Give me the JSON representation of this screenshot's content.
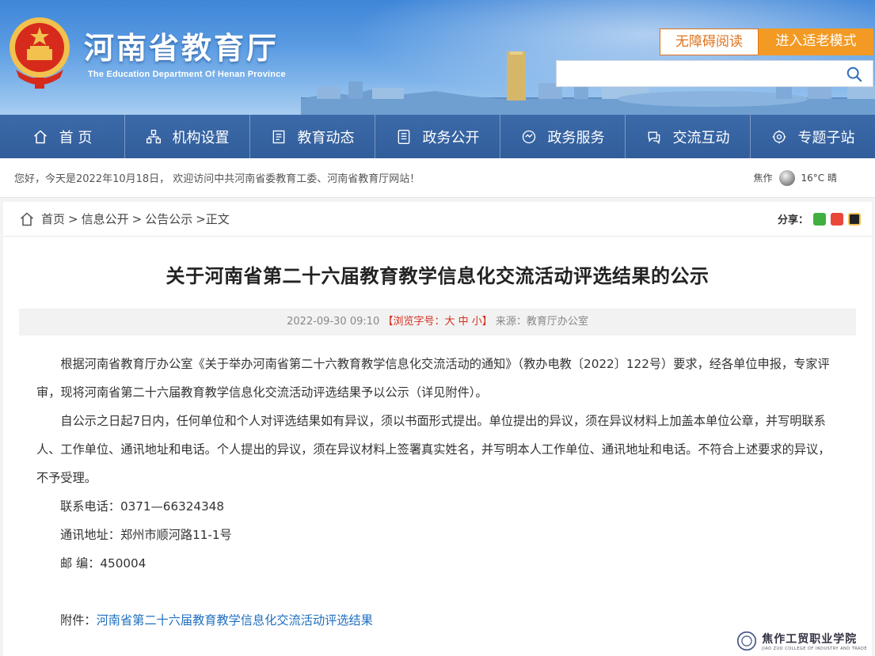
{
  "header": {
    "site_title": "河南省教育厅",
    "site_subtitle": "The Education Department Of Henan Province",
    "accessible_label": "无障碍阅读",
    "elder_mode_label": "进入适老模式",
    "search_placeholder": ""
  },
  "nav": [
    {
      "label": "首 页",
      "icon": "home-icon"
    },
    {
      "label": "机构设置",
      "icon": "org-chart-icon"
    },
    {
      "label": "教育动态",
      "icon": "news-icon"
    },
    {
      "label": "政务公开",
      "icon": "document-icon"
    },
    {
      "label": "政务服务",
      "icon": "service-icon"
    },
    {
      "label": "交流互动",
      "icon": "chat-icon"
    },
    {
      "label": "专题子站",
      "icon": "topic-icon"
    }
  ],
  "infobar": {
    "greeting": "您好，今天是2022年10月18日， 欢迎访问中共河南省委教育工委、河南省教育厅网站！",
    "city": "焦作",
    "weather": "16°C 晴"
  },
  "breadcrumb": {
    "home": "首页",
    "sep": ">",
    "level1": "信息公开",
    "level2": "公告公示",
    "current": ">正文"
  },
  "share": {
    "label": "分享："
  },
  "article": {
    "title": "关于河南省第二十六届教育教学信息化交流活动评选结果的公示",
    "date": "2022-09-30 09:10",
    "font_size_label": "【浏览字号：大 中 小】",
    "source": "来源：教育厅办公室",
    "para1": "根据河南省教育厅办公室《关于举办河南省第二十六教育教学信息化交流活动的通知》（教办电教〔2022〕122号）要求，经各单位申报，专家评审，现将河南省第二十六届教育教学信息化交流活动评选结果予以公示（详见附件）。",
    "para2": "自公示之日起7日内，任何单位和个人对评选结果如有异议，须以书面形式提出。单位提出的异议，须在异议材料上加盖本单位公章，并写明联系人、工作单位、通讯地址和电话。个人提出的异议，须在异议材料上签署真实姓名，并写明本人工作单位、通讯地址和电话。不符合上述要求的异议，不予受理。",
    "phone": "联系电话：0371—66324348",
    "address": "通讯地址：郑州市顺河路11-1号",
    "postcode": "邮 编：450004",
    "attach_label": "附件：",
    "attach_link": "河南省第二十六届教育教学信息化交流活动评选结果"
  },
  "watermark": {
    "name": "焦作工贸职业学院",
    "en": "JIAO ZUO COLLEGE OF INDUSTRY AND TRADE"
  }
}
